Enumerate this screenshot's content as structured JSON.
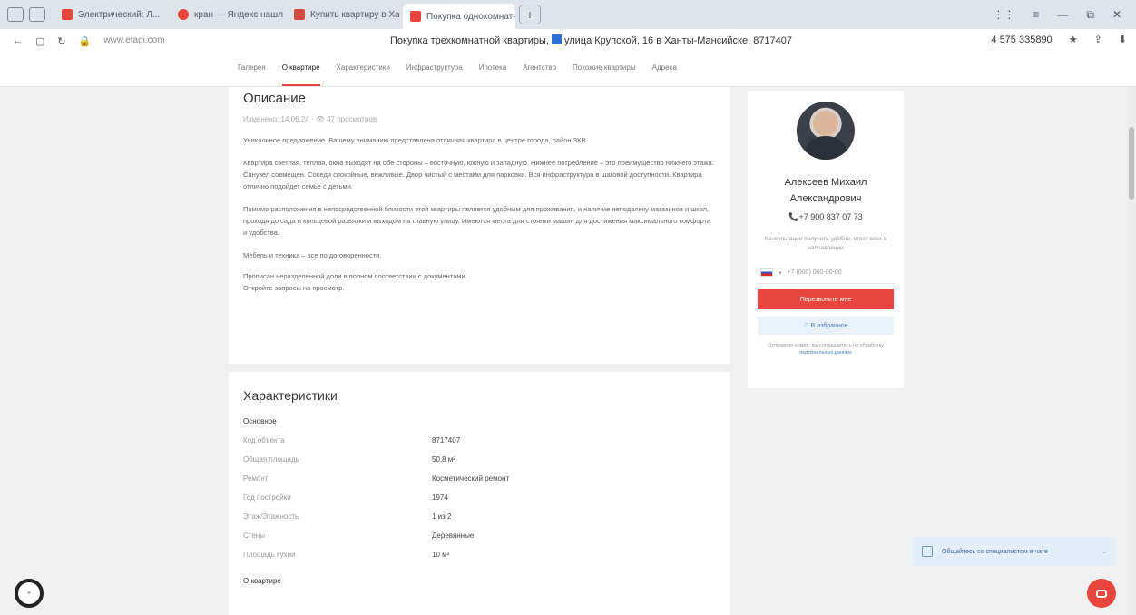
{
  "browser": {
    "tabs": [
      {
        "label": "Электрический: Л...",
        "color": "#e8463c"
      },
      {
        "label": "кран — Яндекс нашлось",
        "color": "#e8463c"
      },
      {
        "label": "Купить квартиру в Ханты",
        "color": "#d14a3b"
      },
      {
        "label": "Покупка однокомнатн...",
        "color": "#e8463c",
        "active": true
      }
    ],
    "new_tab": "+",
    "url": "www.etagi.com",
    "page_title_prefix": "Покупка трехкомнатной квартиры,",
    "page_title_suffix": "улица Крупской, 16 в Ханты-Мансийске, 8717407",
    "toolbar_link": "4 575 335890",
    "controls": [
      "⋮⋮",
      "≡",
      "—",
      "⧉",
      "✕"
    ]
  },
  "site_nav": {
    "items": [
      "Галерея",
      "О квартире",
      "Характеристики",
      "Инфраструктура",
      "Ипотека",
      "Агентство",
      "Похожие квартиры",
      "Адреса"
    ],
    "active_index": 1
  },
  "description": {
    "title": "Описание",
    "meta": "Изменено: 14.06.24 · 👁 47 просмотров",
    "paragraphs": [
      "Уникальное предложение. Вашему вниманию представлена отличная квартира в центре города, район ЗКВ.",
      "Квартира светлая, тёплая, окна выходят на обе стороны – восточную, южную и западную. Нижнее потребление – это преимущество нижнего этажа. Санузел совмещен. Соседи спокойные, вежливые. Двор чистый с местами для парковки. Вся инфраструктура в шаговой доступности. Квартира отлично подойдет семье с детьми.",
      "Помимо расположения в непосредственной близости этой квартиры является удобным для проживания, и наличие неподалеку магазинов и школ, проходя до сада и кольцевой развязки и выходом на главную улицу. Имеются места для стоянки машин для достижения максимального комфорта и удобства.",
      "Мебель и техника – все по договоренности.",
      "Прописан неразделенной доли в полном соответствии с документами.",
      "Откройте запросы на просмотр."
    ]
  },
  "characteristics": {
    "title": "Характеристики",
    "section_main": "Основное",
    "rows": [
      {
        "label": "Код объекта",
        "value": "8717407"
      },
      {
        "label": "Общая площадь",
        "value": "50,8 м²"
      },
      {
        "label": "Ремонт",
        "value": "Косметический ремонт"
      },
      {
        "label": "Год постройки",
        "value": "1974"
      },
      {
        "label": "Этаж/Этажность",
        "value": "1 из 2"
      },
      {
        "label": "Стены",
        "value": "Деревянные"
      },
      {
        "label": "Площадь кухни",
        "value": "10 м²"
      }
    ],
    "section_about": "О квартире"
  },
  "agent": {
    "name": "Алексеев Михаил Александрович",
    "phone": "📞+7 900 837 07 73",
    "note": "Консультации получить удобно, ответ всех в направлении",
    "input_placeholder": "+7 (000) 000-00-00",
    "cta_label": "Перезвоните мне",
    "favorite_label": "♡  В избранное",
    "legal_text": "Отправляя номер, вы соглашаетесь на обработку",
    "legal_link": "персональных данных"
  },
  "chat_toast": {
    "text": "Общайтесь со специалистом в чате",
    "close": "⌄"
  },
  "a11y_button": "◦"
}
